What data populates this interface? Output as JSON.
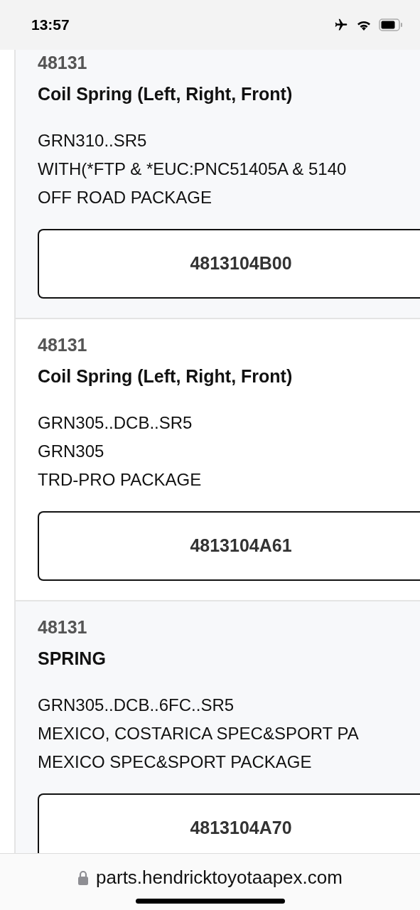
{
  "status_bar": {
    "time": "13:57"
  },
  "parts": [
    {
      "group": "48131",
      "name": "Coil Spring (Left, Right, Front)",
      "applicability": [
        "GRN310..SR5",
        "WITH(*FTP & *EUC:PNC51405A & 5140",
        "OFF ROAD PACKAGE"
      ],
      "part_number": "4813104B00"
    },
    {
      "group": "48131",
      "name": "Coil Spring (Left, Right, Front)",
      "applicability": [
        "GRN305..DCB..SR5",
        "GRN305",
        "TRD-PRO PACKAGE"
      ],
      "part_number": "4813104A61"
    },
    {
      "group": "48131",
      "name": "SPRING",
      "applicability": [
        "GRN305..DCB..6FC..SR5",
        "MEXICO, COSTARICA SPEC&SPORT PA",
        "MEXICO SPEC&SPORT PACKAGE"
      ],
      "part_number": "4813104A70"
    }
  ],
  "address_bar": {
    "url": "parts.hendricktoyotaapex.com"
  }
}
